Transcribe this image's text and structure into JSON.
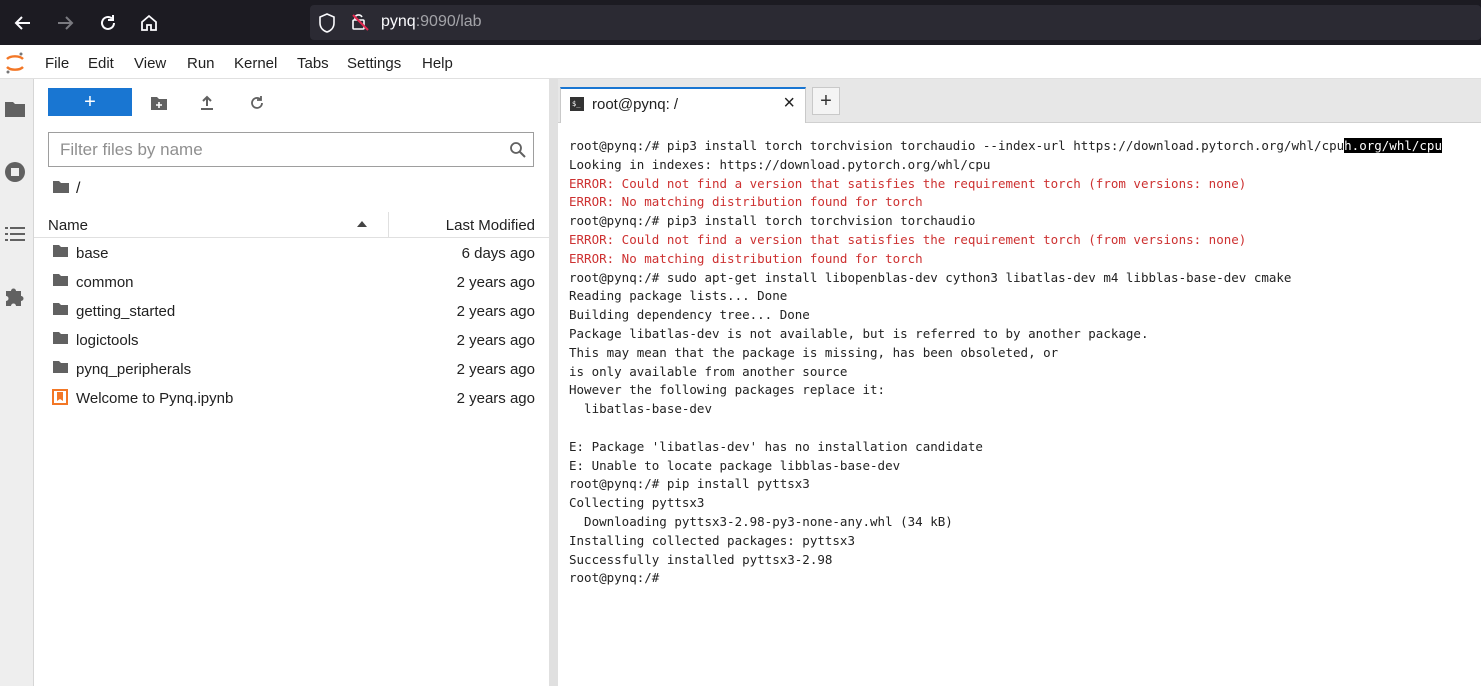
{
  "browser": {
    "url_host": "pynq",
    "url_rest": ":9090/lab"
  },
  "menu": [
    "File",
    "Edit",
    "View",
    "Run",
    "Kernel",
    "Tabs",
    "Settings",
    "Help"
  ],
  "filebrowser": {
    "new_label": "+",
    "filter_placeholder": "Filter files by name",
    "breadcrumb": "/",
    "col_name": "Name",
    "col_modified": "Last Modified",
    "files": [
      {
        "name": "base",
        "modified": "6 days ago",
        "type": "folder"
      },
      {
        "name": "common",
        "modified": "2 years ago",
        "type": "folder"
      },
      {
        "name": "getting_started",
        "modified": "2 years ago",
        "type": "folder"
      },
      {
        "name": "logictools",
        "modified": "2 years ago",
        "type": "folder"
      },
      {
        "name": "pynq_peripherals",
        "modified": "2 years ago",
        "type": "folder"
      },
      {
        "name": "Welcome to Pynq.ipynb",
        "modified": "2 years ago",
        "type": "notebook"
      }
    ]
  },
  "tab": {
    "label": "root@pynq: /",
    "close": "×",
    "add": "+"
  },
  "terminal": {
    "highlight": "h.org/whl/cpu",
    "lines": [
      {
        "text": "root@pynq:/# pip3 install torch torchvision torchaudio --index-url https://download.pytorch.org/whl/cpu",
        "kind": "normal"
      },
      {
        "text": "Looking in indexes: https://download.pytorch.org/whl/cpu",
        "kind": "normal"
      },
      {
        "text": "ERROR: Could not find a version that satisfies the requirement torch (from versions: none)",
        "kind": "err"
      },
      {
        "text": "ERROR: No matching distribution found for torch",
        "kind": "err"
      },
      {
        "text": "root@pynq:/# pip3 install torch torchvision torchaudio",
        "kind": "normal"
      },
      {
        "text": "ERROR: Could not find a version that satisfies the requirement torch (from versions: none)",
        "kind": "err"
      },
      {
        "text": "ERROR: No matching distribution found for torch",
        "kind": "err"
      },
      {
        "text": "root@pynq:/# sudo apt-get install libopenblas-dev cython3 libatlas-dev m4 libblas-base-dev cmake",
        "kind": "normal"
      },
      {
        "text": "Reading package lists... Done",
        "kind": "normal"
      },
      {
        "text": "Building dependency tree... Done",
        "kind": "normal"
      },
      {
        "text": "Package libatlas-dev is not available, but is referred to by another package.",
        "kind": "normal"
      },
      {
        "text": "This may mean that the package is missing, has been obsoleted, or",
        "kind": "normal"
      },
      {
        "text": "is only available from another source",
        "kind": "normal"
      },
      {
        "text": "However the following packages replace it:",
        "kind": "normal"
      },
      {
        "text": "  libatlas-base-dev",
        "kind": "normal"
      },
      {
        "text": "",
        "kind": "normal"
      },
      {
        "text": "E: Package 'libatlas-dev' has no installation candidate",
        "kind": "normal"
      },
      {
        "text": "E: Unable to locate package libblas-base-dev",
        "kind": "normal"
      },
      {
        "text": "root@pynq:/# pip install pyttsx3",
        "kind": "normal"
      },
      {
        "text": "Collecting pyttsx3",
        "kind": "normal"
      },
      {
        "text": "  Downloading pyttsx3-2.98-py3-none-any.whl (34 kB)",
        "kind": "normal"
      },
      {
        "text": "Installing collected packages: pyttsx3",
        "kind": "normal"
      },
      {
        "text": "Successfully installed pyttsx3-2.98",
        "kind": "normal"
      },
      {
        "text": "root@pynq:/#",
        "kind": "normal"
      }
    ]
  },
  "colors": {
    "accent": "#1976d2",
    "error_text": "#cd3131",
    "logo": "#f37726"
  }
}
